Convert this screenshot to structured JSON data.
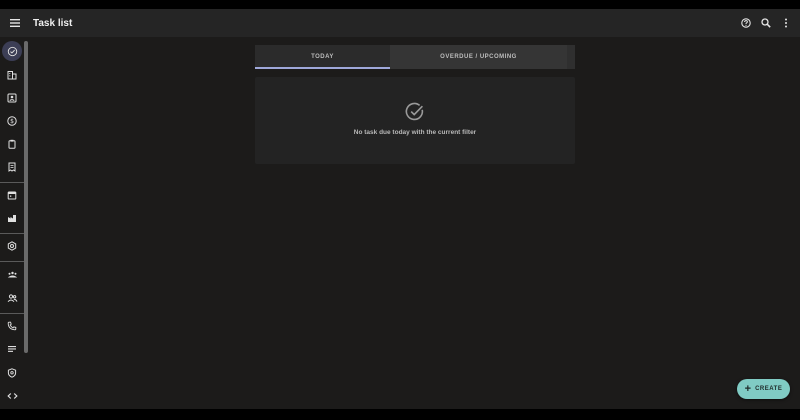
{
  "app": {
    "title": "Task list"
  },
  "toolbar": {
    "menu_icon": "menu-icon",
    "help_icon": "help-icon",
    "search_icon": "search-icon",
    "more_icon": "more-vert-icon"
  },
  "rail": {
    "items": [
      {
        "icon": "check-circle-icon",
        "active": true
      },
      {
        "icon": "building-icon"
      },
      {
        "icon": "contact-card-icon"
      },
      {
        "icon": "dollar-icon"
      },
      {
        "icon": "clipboard-icon"
      },
      {
        "icon": "receipt-icon"
      },
      {
        "icon": "calendar-icon"
      },
      {
        "icon": "factory-icon"
      },
      {
        "icon": "settings-hex-icon"
      },
      {
        "icon": "group-icon"
      },
      {
        "icon": "people-icon"
      },
      {
        "icon": "phone-icon"
      },
      {
        "icon": "list-icon"
      },
      {
        "icon": "shield-icon"
      },
      {
        "icon": "code-icon"
      }
    ]
  },
  "tabs": [
    {
      "label": "TODAY",
      "selected": true
    },
    {
      "label": "OVERDUE / UPCOMING",
      "selected": false
    }
  ],
  "empty_state": {
    "icon": "check-circle-icon",
    "message": "No task due today with the current filter"
  },
  "fab": {
    "label": "CREATE",
    "icon": "plus-icon"
  },
  "colors": {
    "accent": "#9fa8da",
    "fab": "#80cbc4",
    "background": "#1c1b1a",
    "topbar": "#252525"
  }
}
